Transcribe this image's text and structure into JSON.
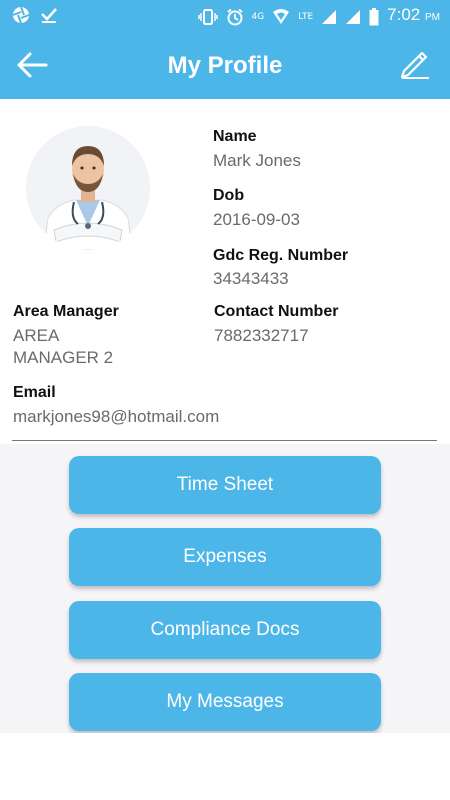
{
  "status_bar": {
    "time": "7:02",
    "ampm": "PM",
    "network_4g": "4G",
    "network_lte": "LTE",
    "icons": [
      "aperture-icon",
      "check-icon",
      "vibrate-icon",
      "alarm-icon",
      "wifi-icon",
      "signal-icon",
      "battery-icon"
    ]
  },
  "app_bar": {
    "title": "My Profile",
    "back_icon": "arrow-left-icon",
    "edit_icon": "pencil-icon"
  },
  "profile": {
    "name_label": "Name",
    "name_value": "Mark Jones",
    "dob_label": "Dob",
    "dob_value": "2016-09-03",
    "gdc_label": "Gdc Reg. Number",
    "gdc_value": "34343433",
    "area_manager_label": "Area Manager",
    "area_manager_value_line1": "AREA",
    "area_manager_value_line2": "MANAGER 2",
    "contact_label": "Contact Number",
    "contact_value": "7882332717",
    "email_label": "Email",
    "email_value": "markjones98@hotmail.com"
  },
  "actions": [
    {
      "label": "Time Sheet"
    },
    {
      "label": "Expenses"
    },
    {
      "label": "Compliance Docs"
    },
    {
      "label": "My Messages"
    }
  ],
  "colors": {
    "primary": "#4db6e9",
    "label_text": "#111111",
    "value_text": "#6a6a6a",
    "background": "#f5f5f8"
  }
}
